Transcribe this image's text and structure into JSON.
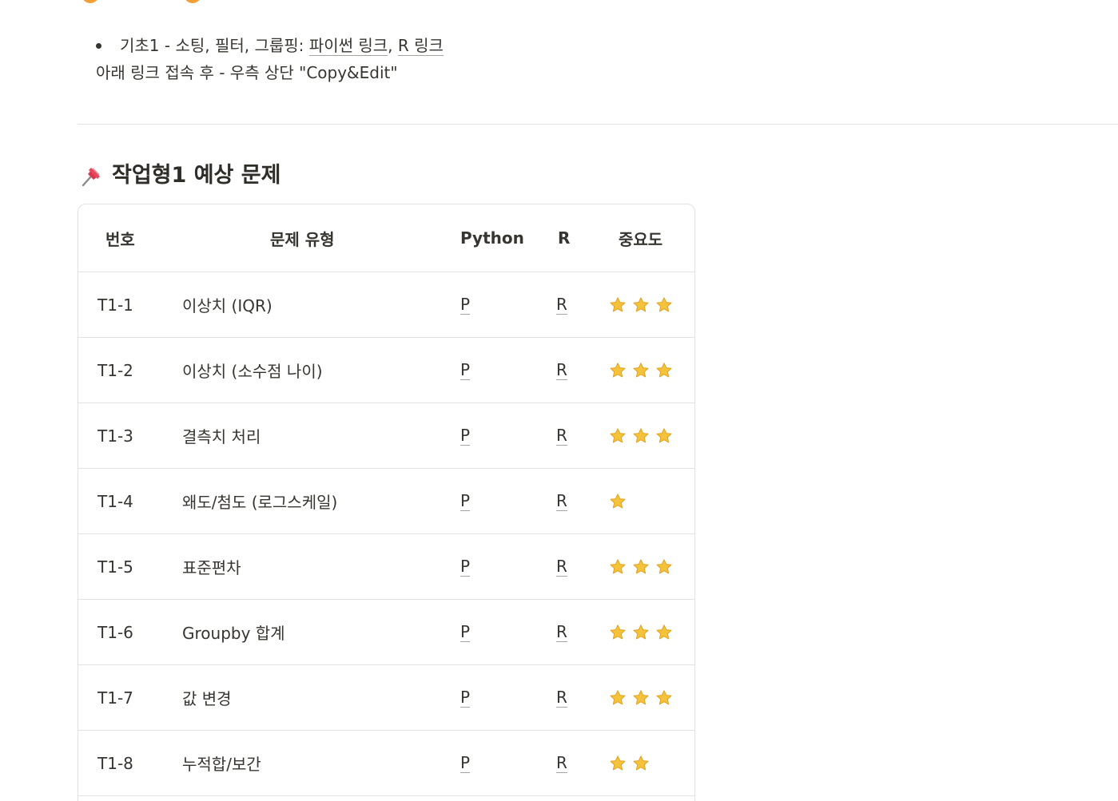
{
  "intro": {
    "bullet_prefix": "기초1 - 소팅, 필터, 그룹핑: ",
    "python_link": "파이썬 링크",
    "separator": ", ",
    "r_link": "R 링크",
    "note": "아래 링크 접속 후 - 우측 상단 \"Copy&Edit\""
  },
  "section": {
    "icon": "pushpin-icon",
    "title": "작업형1 예상 문제"
  },
  "table": {
    "headers": {
      "num": "번호",
      "type": "문제 유형",
      "python": "Python",
      "r": "R",
      "importance": "중요도"
    },
    "rows": [
      {
        "num": "T1-1",
        "type": "이상치 (IQR)",
        "python": "P",
        "r": "R",
        "stars": 3
      },
      {
        "num": "T1-2",
        "type": "이상치 (소수점 나이)",
        "python": "P",
        "r": "R",
        "stars": 3
      },
      {
        "num": "T1-3",
        "type": "결측치 처리",
        "python": "P",
        "r": "R",
        "stars": 3
      },
      {
        "num": "T1-4",
        "type": "왜도/첨도 (로그스케일)",
        "python": "P",
        "r": "R",
        "stars": 1
      },
      {
        "num": "T1-5",
        "type": "표준편차",
        "python": "P",
        "r": "R",
        "stars": 3
      },
      {
        "num": "T1-6",
        "type": "Groupby 합계",
        "python": "P",
        "r": "R",
        "stars": 3
      },
      {
        "num": "T1-7",
        "type": "값 변경",
        "python": "P",
        "r": "R",
        "stars": 3
      },
      {
        "num": "T1-8",
        "type": "누적합/보간",
        "python": "P",
        "r": "R",
        "stars": 2
      }
    ]
  },
  "colors": {
    "text": "#37352f",
    "divider": "#e3e2e0",
    "star": "#f5c33b"
  }
}
